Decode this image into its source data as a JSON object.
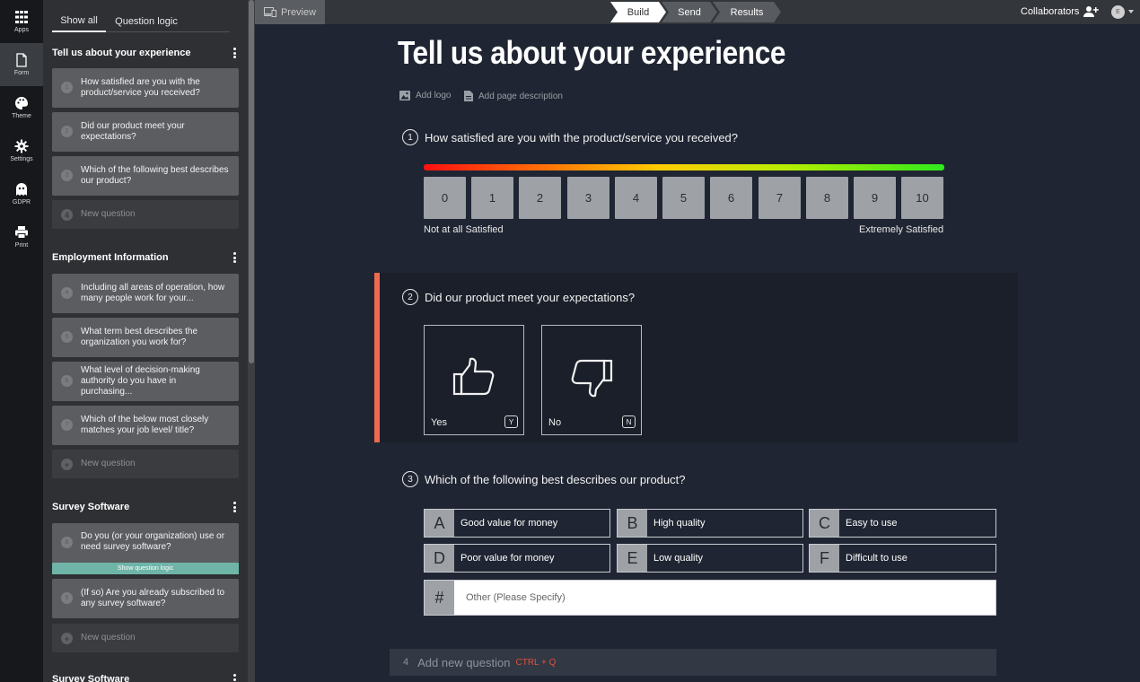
{
  "rail": [
    {
      "label": "Apps",
      "icon": "grid-icon"
    },
    {
      "label": "Form",
      "icon": "document-icon"
    },
    {
      "label": "Theme",
      "icon": "palette-icon"
    },
    {
      "label": "Settings",
      "icon": "gear-icon"
    },
    {
      "label": "GDPR",
      "icon": "ghost-icon"
    },
    {
      "label": "Print",
      "icon": "printer-icon"
    }
  ],
  "sidebar": {
    "tabs": [
      "Show all",
      "Question logic"
    ],
    "sections": [
      {
        "title": "Tell us about your experience",
        "questions": [
          {
            "num": "1",
            "text": "How satisfied are you with the product/service you received?"
          },
          {
            "num": "2",
            "text": "Did our product meet your expectations?"
          },
          {
            "num": "3",
            "text": "Which of the following best describes our product?"
          }
        ],
        "new_num": "4",
        "new_label": "New question"
      },
      {
        "title": "Employment Information",
        "questions": [
          {
            "num": "4",
            "text": "Including all areas of operation, how many people work for your..."
          },
          {
            "num": "5",
            "text": "What term best describes the organization you work for?"
          },
          {
            "num": "6",
            "text": "What level of decision-making authority do you have in purchasing..."
          },
          {
            "num": "7",
            "text": "Which of the below most closely matches your job level/ title?"
          }
        ],
        "new_label": "New question"
      },
      {
        "title": "Survey Software",
        "questions": [
          {
            "num": "8",
            "text": "Do you (or your organization) use or need survey software?"
          },
          {
            "num": "9",
            "text": "(If so) Are you already subscribed to any survey software?"
          }
        ],
        "logic_label": "Show question logic",
        "new_label": "New question"
      },
      {
        "title": "Survey Software"
      }
    ]
  },
  "topbar": {
    "preview": "Preview",
    "steps": [
      "Build",
      "Send",
      "Results"
    ],
    "collaborators": "Collaborators",
    "avatar_initial": "E"
  },
  "form": {
    "title": "Tell us about your experience",
    "add_logo": "Add logo",
    "add_description": "Add page description",
    "q1": {
      "num": "1",
      "text": "How satisfied are you with the product/service you received?",
      "scale": [
        "0",
        "1",
        "2",
        "3",
        "4",
        "5",
        "6",
        "7",
        "8",
        "9",
        "10"
      ],
      "low_label": "Not at all Satisfied",
      "high_label": "Extremely Satisfied"
    },
    "q2": {
      "num": "2",
      "text": "Did our product meet your expectations?",
      "yes_label": "Yes",
      "yes_key": "Y",
      "no_label": "No",
      "no_key": "N"
    },
    "q3": {
      "num": "3",
      "text": "Which of the following best describes our product?",
      "options": [
        {
          "key": "A",
          "label": "Good value for money"
        },
        {
          "key": "B",
          "label": "High quality"
        },
        {
          "key": "C",
          "label": "Easy to use"
        },
        {
          "key": "D",
          "label": "Poor value for money"
        },
        {
          "key": "E",
          "label": "Low quality"
        },
        {
          "key": "F",
          "label": "Difficult to use"
        }
      ],
      "other_key": "#",
      "other_placeholder": "Other (Please Specify)"
    },
    "add_question": {
      "num": "4",
      "label": "Add new question",
      "shortcut": "CTRL + Q"
    }
  },
  "colors": {
    "accent": "#ee6a4f",
    "logic": "#6fb5a7",
    "background": "#1f2532"
  }
}
